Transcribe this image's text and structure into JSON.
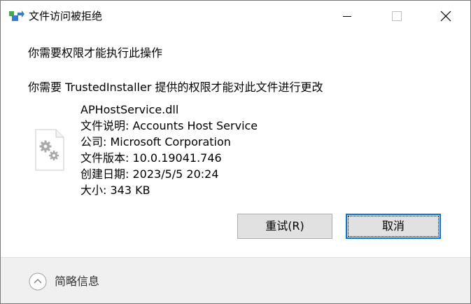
{
  "window": {
    "title": "文件访问被拒绝",
    "controls": {
      "minimize_icon": "minimize-icon",
      "maximize_icon": "maximize-icon",
      "close_icon": "close-icon"
    }
  },
  "content": {
    "header": "你需要权限才能执行此操作",
    "description": "你需要 TrustedInstaller 提供的权限才能对此文件进行更改",
    "file": {
      "icon": "settings-file-icon",
      "name": "APHostService.dll",
      "description_line": "文件说明: Accounts Host Service",
      "company_line": "公司: Microsoft Corporation",
      "version_line": "文件版本: 10.0.19041.746",
      "created_line": "创建日期: 2023/5/5 20:24",
      "size_line": "大小: 343 KB"
    }
  },
  "buttons": {
    "retry_label": "重试(R)",
    "cancel_label": "取消"
  },
  "footer": {
    "expand_icon": "chevron-up-icon",
    "details_label": "简略信息"
  },
  "colors": {
    "accent": "#0078d7",
    "button_bg": "#e1e1e1",
    "footer_bg": "#f0f0f0"
  }
}
